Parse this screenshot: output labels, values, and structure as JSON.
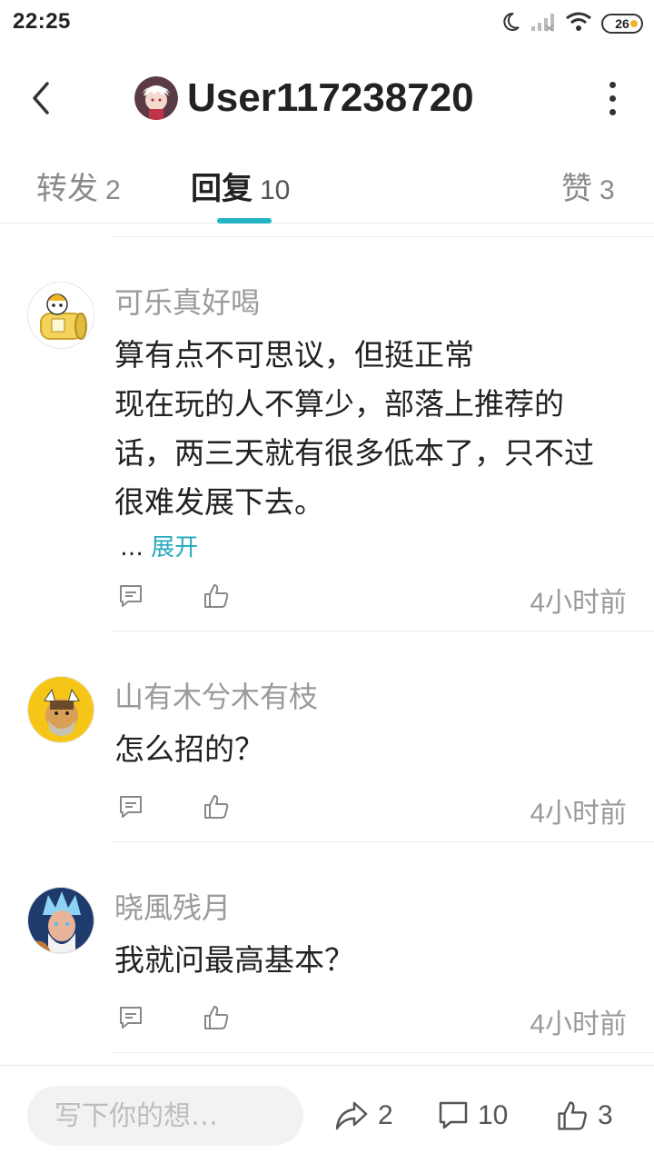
{
  "status_bar": {
    "time": "22:25",
    "battery": "26"
  },
  "header": {
    "username": "User117238720"
  },
  "tabs": [
    {
      "label": "转发",
      "count": "2"
    },
    {
      "label": "回复",
      "count": "10"
    },
    {
      "label": "赞",
      "count": "3"
    }
  ],
  "active_tab": "回复",
  "comments": [
    {
      "name": "可乐真好喝",
      "text": "算有点不可思议，但挺正常\n现在玩的人不算少，部落上推荐的话，两三天就有很多低本了，只不过很难发展下去。",
      "expand_prefix": "…",
      "expand_link": "展开",
      "time": "4小时前"
    },
    {
      "name": "山有木兮木有枝",
      "text": "怎么招的？",
      "time": "4小时前"
    },
    {
      "name": "晓風残月",
      "text": "我就问最高基本？",
      "time": "4小时前"
    }
  ],
  "bottom_bar": {
    "input_placeholder": "写下你的想…",
    "repost_count": "2",
    "comment_count": "10",
    "like_count": "3"
  },
  "colors": {
    "accent": "#26b3c6",
    "link": "#26a8bd",
    "muted_text": "#9a9a9a",
    "primary_text": "#222222"
  }
}
